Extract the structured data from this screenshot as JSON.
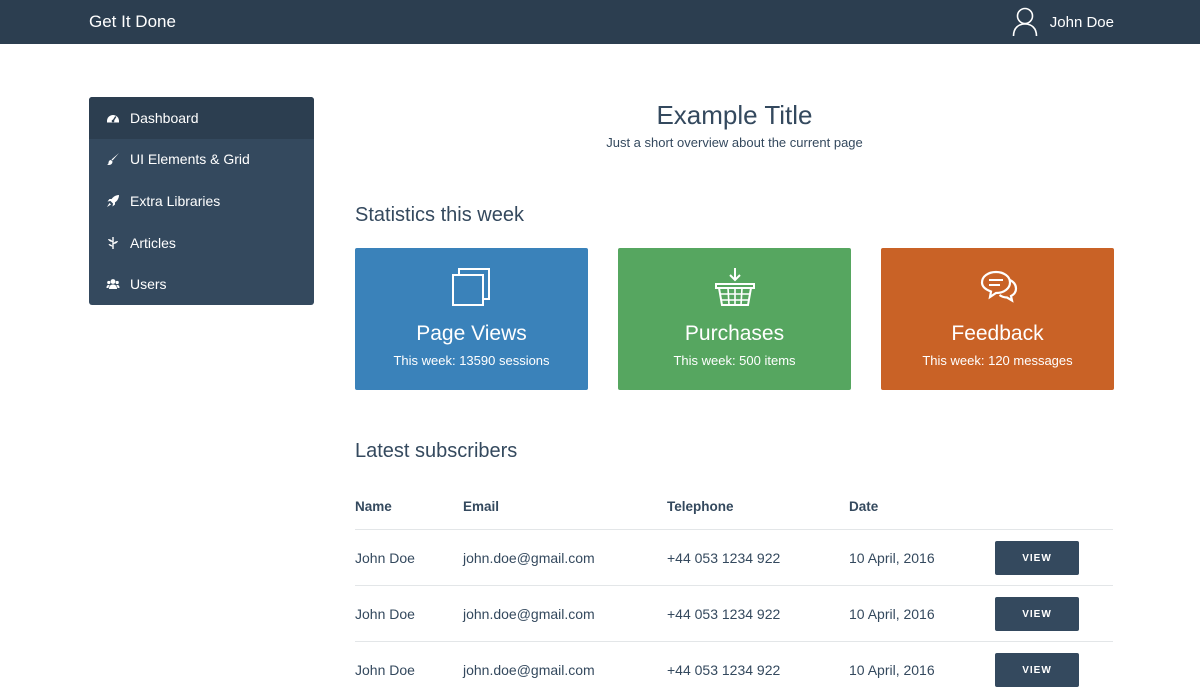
{
  "header": {
    "brand": "Get It Done",
    "user_name": "John Doe",
    "user_icon": "user-outline-icon"
  },
  "sidebar": {
    "items": [
      {
        "label": "Dashboard",
        "icon": "dashboard-icon",
        "active": true
      },
      {
        "label": "UI Elements & Grid",
        "icon": "paint-brush-icon",
        "active": false
      },
      {
        "label": "Extra Libraries",
        "icon": "rocket-icon",
        "active": false
      },
      {
        "label": "Articles",
        "icon": "leaf-icon",
        "active": false
      },
      {
        "label": "Users",
        "icon": "users-icon",
        "active": false
      }
    ]
  },
  "page": {
    "title": "Example Title",
    "subtitle": "Just a short overview about the current page"
  },
  "stats": {
    "heading": "Statistics this week",
    "cards": [
      {
        "label": "Page Views",
        "sub": "This week: 13590 sessions",
        "icon": "copy-pages-icon",
        "color": "#3a82ba"
      },
      {
        "label": "Purchases",
        "sub": "This week: 500 items",
        "icon": "basket-icon",
        "color": "#56a660"
      },
      {
        "label": "Feedback",
        "sub": "This week: 120 messages",
        "icon": "chat-bubbles-icon",
        "color": "#c96226"
      }
    ]
  },
  "subscribers": {
    "heading": "Latest subscribers",
    "columns": [
      "Name",
      "Email",
      "Telephone",
      "Date"
    ],
    "rows": [
      {
        "name": "John Doe",
        "email": "john.doe@gmail.com",
        "telephone": "+44 053 1234 922",
        "date": "10 April, 2016",
        "action": "VIEW"
      },
      {
        "name": "John Doe",
        "email": "john.doe@gmail.com",
        "telephone": "+44 053 1234 922",
        "date": "10 April, 2016",
        "action": "VIEW"
      },
      {
        "name": "John Doe",
        "email": "john.doe@gmail.com",
        "telephone": "+44 053 1234 922",
        "date": "10 April, 2016",
        "action": "VIEW"
      }
    ]
  },
  "colors": {
    "header_bg": "#2c3e50",
    "sidebar_bg": "#34495e",
    "sidebar_active_bg": "#2c3e50",
    "button_bg": "#34495e"
  }
}
